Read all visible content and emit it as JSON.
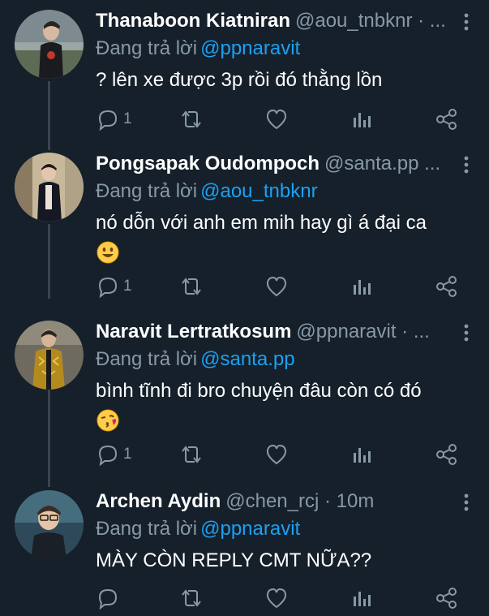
{
  "tweets": [
    {
      "name": "Thanaboon Kiatniran",
      "handle": "@aou_tnbknr · ...",
      "replying_label": "Đang trả lời",
      "replying_to": "@ppnaravit",
      "text": "? lên xe được 3p rồi đó thằng lồn",
      "reply_count": "1",
      "emoji": ""
    },
    {
      "name": "Pongsapak Oudompoch",
      "handle": "@santa.pp ...",
      "replying_label": "Đang trả lời",
      "replying_to": "@aou_tnbknr",
      "text": "nó dỗn với anh em mih hay gì á đại ca",
      "reply_count": "1",
      "emoji": "smiling-face"
    },
    {
      "name": "Naravit Lertratkosum",
      "handle": "@ppnaravit · ...",
      "replying_label": "Đang trả lời",
      "replying_to": "@santa.pp",
      "text": "bình tĩnh đi bro chuyện đâu còn có đó",
      "reply_count": "1",
      "emoji": "kissing-face"
    },
    {
      "name": "Archen Aydin",
      "handle": "@chen_rcj · 10m",
      "replying_label": "Đang trả lời",
      "replying_to": "@ppnaravit",
      "text": "MÀY CÒN REPLY CMT NỮA??",
      "reply_count": "",
      "emoji": ""
    }
  ],
  "colors": {
    "background": "#15202b",
    "muted": "#8899a6",
    "link": "#1da1f2",
    "thread_line": "#38444d"
  }
}
